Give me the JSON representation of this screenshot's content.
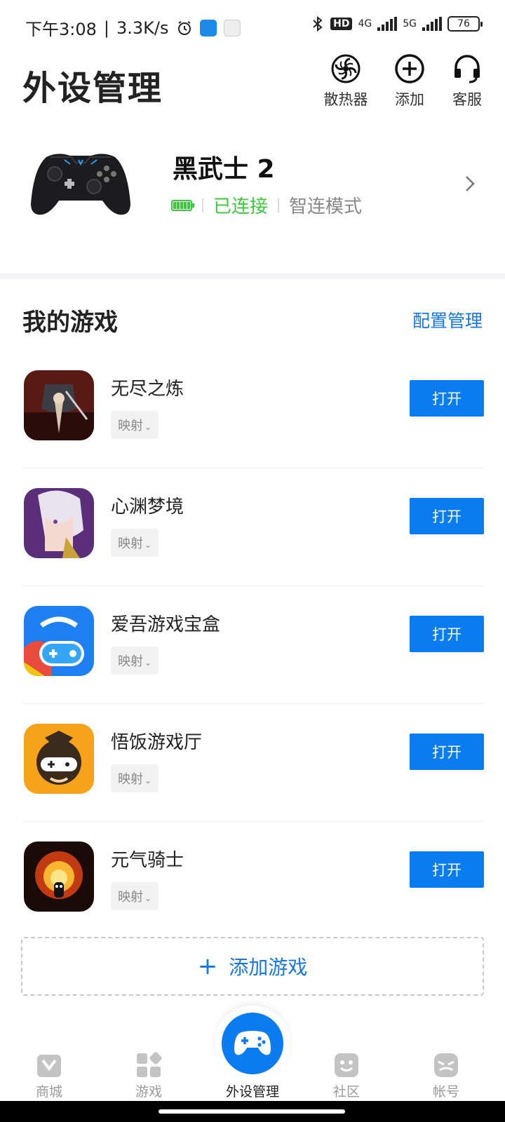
{
  "status_bar": {
    "time": "下午3:08",
    "speed": "3.3K/s",
    "hd_badge": "HD",
    "net1": "4G",
    "net2": "5G",
    "battery": "76"
  },
  "header": {
    "title": "外设管理",
    "actions": [
      {
        "label": "散热器",
        "icon": "fan-icon"
      },
      {
        "label": "添加",
        "icon": "add-circle-icon"
      },
      {
        "label": "客服",
        "icon": "headset-icon"
      }
    ]
  },
  "device": {
    "name": "黑武士 2",
    "status": "已连接",
    "mode": "智连模式",
    "colors": {
      "connected": "#3dc83d"
    }
  },
  "games_section": {
    "title": "我的游戏",
    "config_link": "配置管理",
    "games": [
      {
        "name": "无尽之炼",
        "tag": "映射",
        "button": "打开"
      },
      {
        "name": "心渊梦境",
        "tag": "映射",
        "button": "打开"
      },
      {
        "name": "爱吾游戏宝盒",
        "tag": "映射",
        "button": "打开"
      },
      {
        "name": "悟饭游戏厅",
        "tag": "映射",
        "button": "打开"
      },
      {
        "name": "元气骑士",
        "tag": "映射",
        "button": "打开"
      }
    ],
    "add_button": "添加游戏"
  },
  "bottom_nav": {
    "items": [
      {
        "label": "商城",
        "icon": "store-icon"
      },
      {
        "label": "游戏",
        "icon": "games-grid-icon"
      },
      {
        "label": "外设管理",
        "icon": "gamepad-icon"
      },
      {
        "label": "社区",
        "icon": "community-icon"
      },
      {
        "label": "帐号",
        "icon": "account-icon"
      }
    ]
  },
  "accent_color": "#0a7cf0"
}
